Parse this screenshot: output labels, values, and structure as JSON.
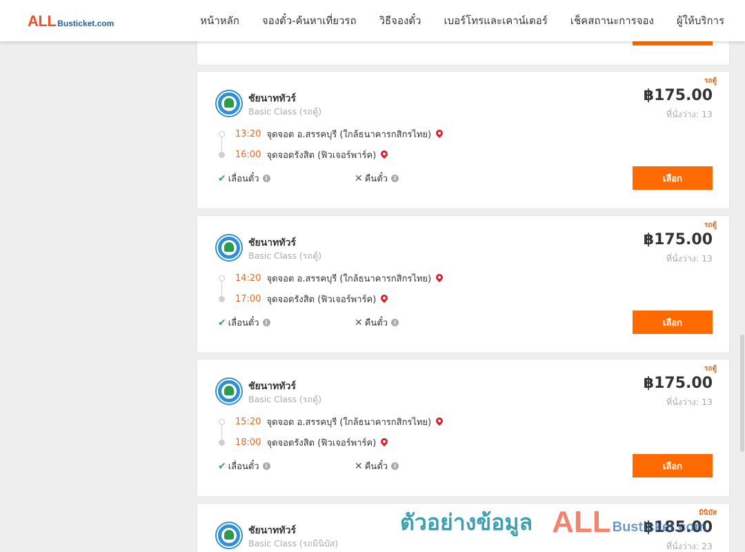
{
  "header": {
    "logo_all": "ALL",
    "logo_rest": "Busticket.com",
    "nav": [
      "หน้าหลัก",
      "จองตั๋ว-ค้นหาเที่ยวรถ",
      "วิธีจองตั๋ว",
      "เบอร์โทรและเคาน์เตอร์",
      "เช็คสถานะการจอง",
      "ผู้ให้บริการ"
    ]
  },
  "trips": [
    {
      "type_tag": "รถตู้",
      "operator": "ชัยนาททัวร์",
      "class": "Basic Class (รถตู้)",
      "price": "฿175.00",
      "seats": "ที่นั่งว่าง: 13",
      "dep_time": "13:20",
      "dep_place": "จุดจอด อ.สรรคบุรี (ใกล้ธนาคารกสิกรไทย)",
      "arr_time": "16:00",
      "arr_place": "จุดจอดรังสิต (ฟิวเจอร์พาร์ค)",
      "policy_change": "เลื่อนตั๋ว",
      "policy_refund": "คืนตั๋ว",
      "select_label": "เลือก"
    },
    {
      "type_tag": "รถตู้",
      "operator": "ชัยนาททัวร์",
      "class": "Basic Class (รถตู้)",
      "price": "฿175.00",
      "seats": "ที่นั่งว่าง: 13",
      "dep_time": "14:20",
      "dep_place": "จุดจอด อ.สรรคบุรี (ใกล้ธนาคารกสิกรไทย)",
      "arr_time": "17:00",
      "arr_place": "จุดจอดรังสิต (ฟิวเจอร์พาร์ค)",
      "policy_change": "เลื่อนตั๋ว",
      "policy_refund": "คืนตั๋ว",
      "select_label": "เลือก"
    },
    {
      "type_tag": "รถตู้",
      "operator": "ชัยนาททัวร์",
      "class": "Basic Class (รถตู้)",
      "price": "฿175.00",
      "seats": "ที่นั่งว่าง: 13",
      "dep_time": "15:20",
      "dep_place": "จุดจอด อ.สรรคบุรี (ใกล้ธนาคารกสิกรไทย)",
      "arr_time": "18:00",
      "arr_place": "จุดจอดรังสิต (ฟิวเจอร์พาร์ค)",
      "policy_change": "เลื่อนตั๋ว",
      "policy_refund": "คืนตั๋ว",
      "select_label": "เลือก"
    },
    {
      "type_tag": "มินิบัส",
      "operator": "ชัยนาททัวร์",
      "class": "Basic Class (รถมินิบัส)",
      "price": "฿185.00",
      "seats": "ที่นั่งว่าง: 23"
    }
  ],
  "watermark": {
    "text": "ตัวอย่างข้อมูล",
    "all": "ALL",
    "rest": "Busticket.com"
  },
  "colors": {
    "accent": "#ff6a00",
    "time": "#e8661a",
    "pin": "#e11d2a",
    "check": "#2fa84f"
  }
}
